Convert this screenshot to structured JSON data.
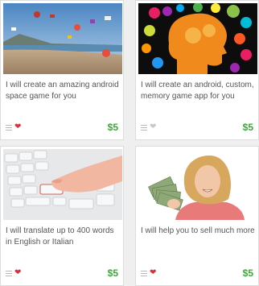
{
  "colors": {
    "price": "#3aa935",
    "heart_active": "#d9303b",
    "heart_inactive": "#c8c8c8",
    "card_text": "#555555"
  },
  "gigs": [
    {
      "title": "I will create an amazing android space game for you",
      "price": "$5",
      "image": "beach-sky-with-game-sprites",
      "icons": [
        "menu-icon",
        "heart-icon"
      ],
      "favorited": true
    },
    {
      "title": "I will create an android, custom, memory game app for you",
      "price": "$5",
      "image": "head-silhouette-with-colorful-icons",
      "icons": [
        "menu-icon",
        "heart-icon"
      ],
      "favorited": false
    },
    {
      "title": "I will translate up to 400 words in English or Italian",
      "price": "$5",
      "image": "finger-pressing-keyboard-key",
      "icons": [
        "menu-icon",
        "heart-icon"
      ],
      "favorited": true
    },
    {
      "title": "I will help you to sell much more",
      "price": "$5",
      "image": "woman-holding-cash",
      "icons": [
        "menu-icon",
        "heart-icon"
      ],
      "favorited": true
    }
  ]
}
